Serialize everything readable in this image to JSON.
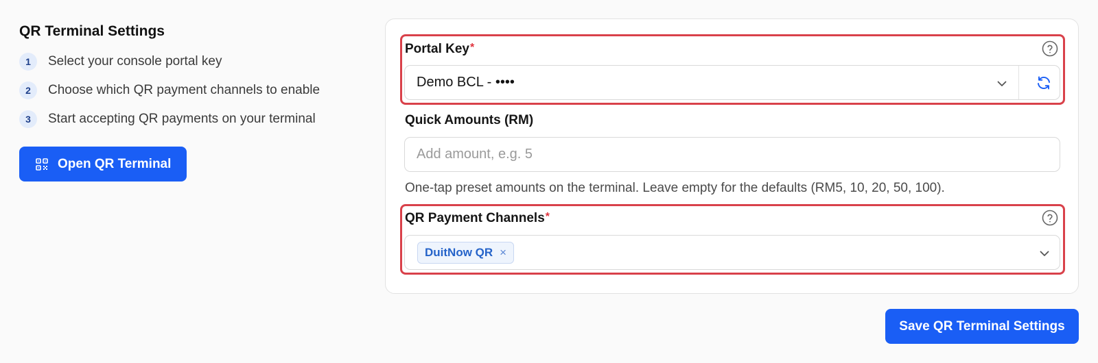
{
  "left": {
    "title": "QR Terminal Settings",
    "steps": [
      {
        "num": "1",
        "text": "Select your console portal key"
      },
      {
        "num": "2",
        "text": "Choose which QR payment channels to enable"
      },
      {
        "num": "3",
        "text": "Start accepting QR payments on your terminal"
      }
    ],
    "open_button": "Open QR Terminal"
  },
  "portal_key": {
    "label": "Portal Key",
    "required_mark": "*",
    "value": "Demo BCL - ••••",
    "help_icon": "question-circle-icon",
    "refresh_icon": "refresh-icon"
  },
  "quick_amounts": {
    "label": "Quick Amounts (RM)",
    "placeholder": "Add amount, e.g. 5",
    "value": "",
    "hint": "One-tap preset amounts on the terminal. Leave empty for the defaults (RM5, 10, 20, 50, 100)."
  },
  "qr_channels": {
    "label": "QR Payment Channels",
    "required_mark": "*",
    "tags": [
      {
        "label": "DuitNow QR",
        "remove": "×"
      }
    ],
    "help_icon": "question-circle-icon"
  },
  "save_button": "Save QR Terminal Settings",
  "colors": {
    "primary": "#1a5ef5",
    "highlight": "#d9414a",
    "required": "#e0333d",
    "tag_bg": "#eef4fd",
    "tag_text": "#2563c9"
  }
}
